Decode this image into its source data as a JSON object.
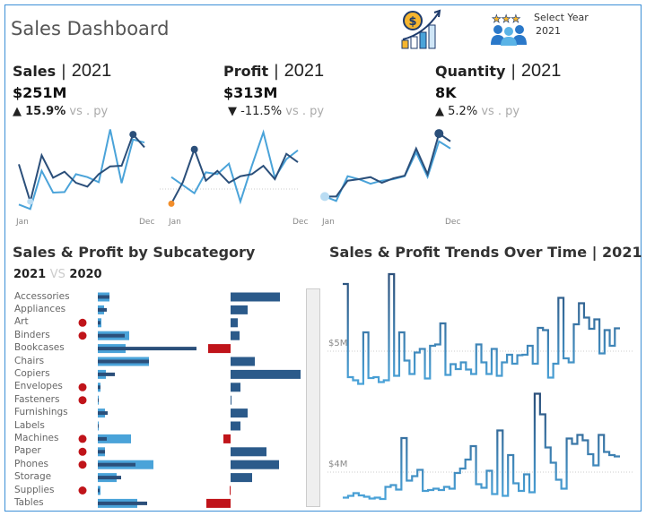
{
  "header": {
    "title": "Sales Dashboard",
    "select_year_label": "Select Year",
    "select_year_value": "2021",
    "icons": [
      "sales-growth-icon",
      "team-stars-icon"
    ]
  },
  "kpis": [
    {
      "name": "Sales",
      "year": "2021",
      "value": "$251M",
      "arrow": "▲",
      "change": "15.9%",
      "vs": "vs . py",
      "bold_change": true
    },
    {
      "name": "Profit",
      "year": "2021",
      "value": "$313M",
      "arrow": "▼",
      "change": "-11.5%",
      "vs": "vs . py",
      "bold_change": false
    },
    {
      "name": "Quantity",
      "year": "2021",
      "value": "8K",
      "arrow": "▲",
      "change": "5.2%",
      "vs": "vs . py",
      "bold_change": false
    }
  ],
  "colors": {
    "current": "#2b4f7a",
    "previous": "#4aa3d9",
    "negative": "#c0141a",
    "low_marker": "#f28e2b",
    "frame": "#3b8fd6"
  },
  "chart_data": [
    {
      "type": "line",
      "id": "sales-sparkline",
      "x_start": "Jan",
      "x_end": "Dec",
      "series": [
        {
          "values": [
            155,
            30,
            185,
            110,
            130,
            93,
            80,
            122,
            148,
            150,
            255,
            212
          ]
        },
        {
          "values": [
            20,
            5,
            133,
            60,
            62,
            122,
            112,
            95,
            272,
            92,
            238,
            228
          ]
        }
      ]
    },
    {
      "type": "line",
      "id": "profit-sparkline",
      "x_start": "Jan",
      "x_end": "Dec",
      "series": [
        {
          "values": [
            23,
            95,
            205,
            100,
            133,
            93,
            115,
            122,
            150,
            105,
            190,
            162
          ]
        },
        {
          "values": [
            112,
            85,
            58,
            128,
            122,
            157,
            30,
            150,
            262,
            110,
            172,
            202
          ]
        }
      ]
    },
    {
      "type": "line",
      "id": "quantity-sparkline",
      "x_start": "Jan",
      "x_end": "Dec",
      "series": [
        {
          "values": [
            47,
            47,
            100,
            105,
            112,
            93,
            108,
            117,
            208,
            122,
            258,
            232
          ]
        },
        {
          "values": [
            47,
            32,
            115,
            105,
            90,
            100,
            105,
            115,
            195,
            113,
            232,
            208
          ]
        }
      ]
    },
    {
      "type": "bar",
      "id": "sales-profit-by-subcategory",
      "title": "Sales & Profit by Subcategory",
      "subtitle_a": "2021",
      "subtitle_vs": "VS",
      "subtitle_b": "2020",
      "categories": [
        "Accessories",
        "Appliances",
        "Art",
        "Binders",
        "Bookcases",
        "Chairs",
        "Copiers",
        "Envelopes",
        "Fasteners",
        "Furnishings",
        "Labels",
        "Machines",
        "Paper",
        "Phones",
        "Storage",
        "Supplies",
        "Tables"
      ],
      "flagged": [
        false,
        false,
        true,
        true,
        false,
        false,
        false,
        true,
        true,
        false,
        false,
        true,
        true,
        true,
        false,
        true,
        false
      ],
      "sales_2021": [
        13,
        7,
        4,
        35,
        31,
        57,
        9,
        3,
        1,
        8,
        1,
        37,
        8,
        62,
        21,
        3,
        44
      ],
      "sales_2020": [
        13,
        10,
        3,
        30,
        110,
        57,
        19,
        3,
        1,
        11,
        1,
        10,
        8,
        42,
        26,
        2,
        55
      ],
      "profit": [
        55,
        19,
        8,
        10,
        -25,
        27,
        78,
        11,
        1,
        19,
        11,
        -8,
        40,
        54,
        24,
        -1,
        -27
      ]
    },
    {
      "type": "line",
      "id": "sales-profit-trends",
      "title": "Sales & Profit Trends Over Time | 2021",
      "step": true,
      "panels": [
        {
          "reference_label": "$5M",
          "reference": 5,
          "values": [
            6.5,
            4.42,
            4.35,
            4.27,
            5.42,
            4.4,
            4.42,
            4.31,
            4.35,
            6.72,
            4.45,
            5.42,
            4.79,
            4.49,
            4.97,
            5.05,
            4.39,
            5.12,
            5.15,
            5.62,
            4.47,
            4.71,
            4.6,
            4.75,
            4.59,
            4.49,
            5.15,
            4.75,
            4.49,
            5.05,
            4.45,
            4.75,
            4.92,
            4.72,
            4.91,
            4.92,
            5.12,
            4.72,
            5.52,
            5.47,
            4.41,
            4.72,
            6.19,
            4.84,
            4.75,
            5.6,
            6.07,
            5.75,
            5.5,
            5.71,
            4.95,
            5.47,
            5.12,
            5.51
          ]
        },
        {
          "reference_label": "$4M",
          "reference": 4,
          "values": [
            3.43,
            3.47,
            3.53,
            3.48,
            3.45,
            3.41,
            3.43,
            3.4,
            3.67,
            3.71,
            3.61,
            4.76,
            3.81,
            3.91,
            4.05,
            3.58,
            3.6,
            3.63,
            3.6,
            3.67,
            3.63,
            3.98,
            4.08,
            4.28,
            4.58,
            3.73,
            3.65,
            4.03,
            3.51,
            4.93,
            3.47,
            4.38,
            3.75,
            3.58,
            3.95,
            3.55,
            5.75,
            5.29,
            4.55,
            4.21,
            3.83,
            3.63,
            4.75,
            4.63,
            4.83,
            4.71,
            4.4,
            4.15,
            4.83,
            4.45,
            4.38,
            4.35
          ]
        }
      ]
    }
  ]
}
